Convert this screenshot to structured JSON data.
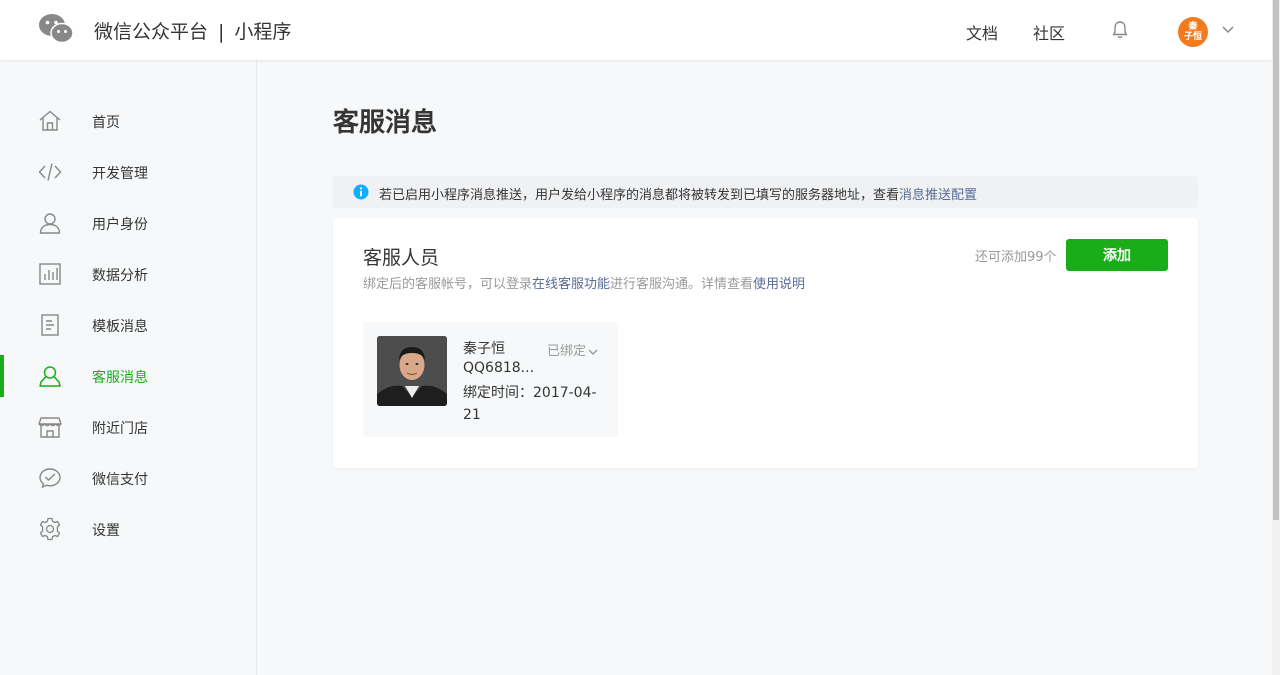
{
  "header": {
    "brand_name": "微信公众平台",
    "separator": "|",
    "product_name": "小程序",
    "links": {
      "docs": "文档",
      "community": "社区"
    },
    "user_avatar_text_line1": "秦",
    "user_avatar_text_line2": "子恒"
  },
  "colors": {
    "accent": "#1aad19",
    "link": "#576b95",
    "info": "#10aeff",
    "avatar": "#f37b1d"
  },
  "sidebar": {
    "items": [
      {
        "label": "首页",
        "icon": "home-icon"
      },
      {
        "label": "开发管理",
        "icon": "code-icon"
      },
      {
        "label": "用户身份",
        "icon": "user-icon"
      },
      {
        "label": "数据分析",
        "icon": "chart-icon"
      },
      {
        "label": "模板消息",
        "icon": "document-icon"
      },
      {
        "label": "客服消息",
        "icon": "customer-service-icon",
        "active": true
      },
      {
        "label": "附近门店",
        "icon": "store-icon"
      },
      {
        "label": "微信支付",
        "icon": "payment-icon"
      },
      {
        "label": "设置",
        "icon": "gear-icon"
      }
    ]
  },
  "main": {
    "title": "客服消息",
    "notice": {
      "text": "若已启用小程序消息推送，用户发给小程序的消息都将被转发到已填写的服务器地址，查看",
      "link": "消息推送配置"
    },
    "card": {
      "title": "客服人员",
      "desc_prefix": "绑定后的客服帐号，可以登录",
      "desc_link1": "在线客服功能",
      "desc_middle": "进行客服沟通。详情查看",
      "desc_link2": "使用说明",
      "remaining": "还可添加99个",
      "add_button": "添加",
      "staff": [
        {
          "name": "秦子恒",
          "account": "QQ6818...",
          "bind_time": "绑定时间：2017-04-21",
          "status": "已绑定"
        }
      ]
    }
  }
}
